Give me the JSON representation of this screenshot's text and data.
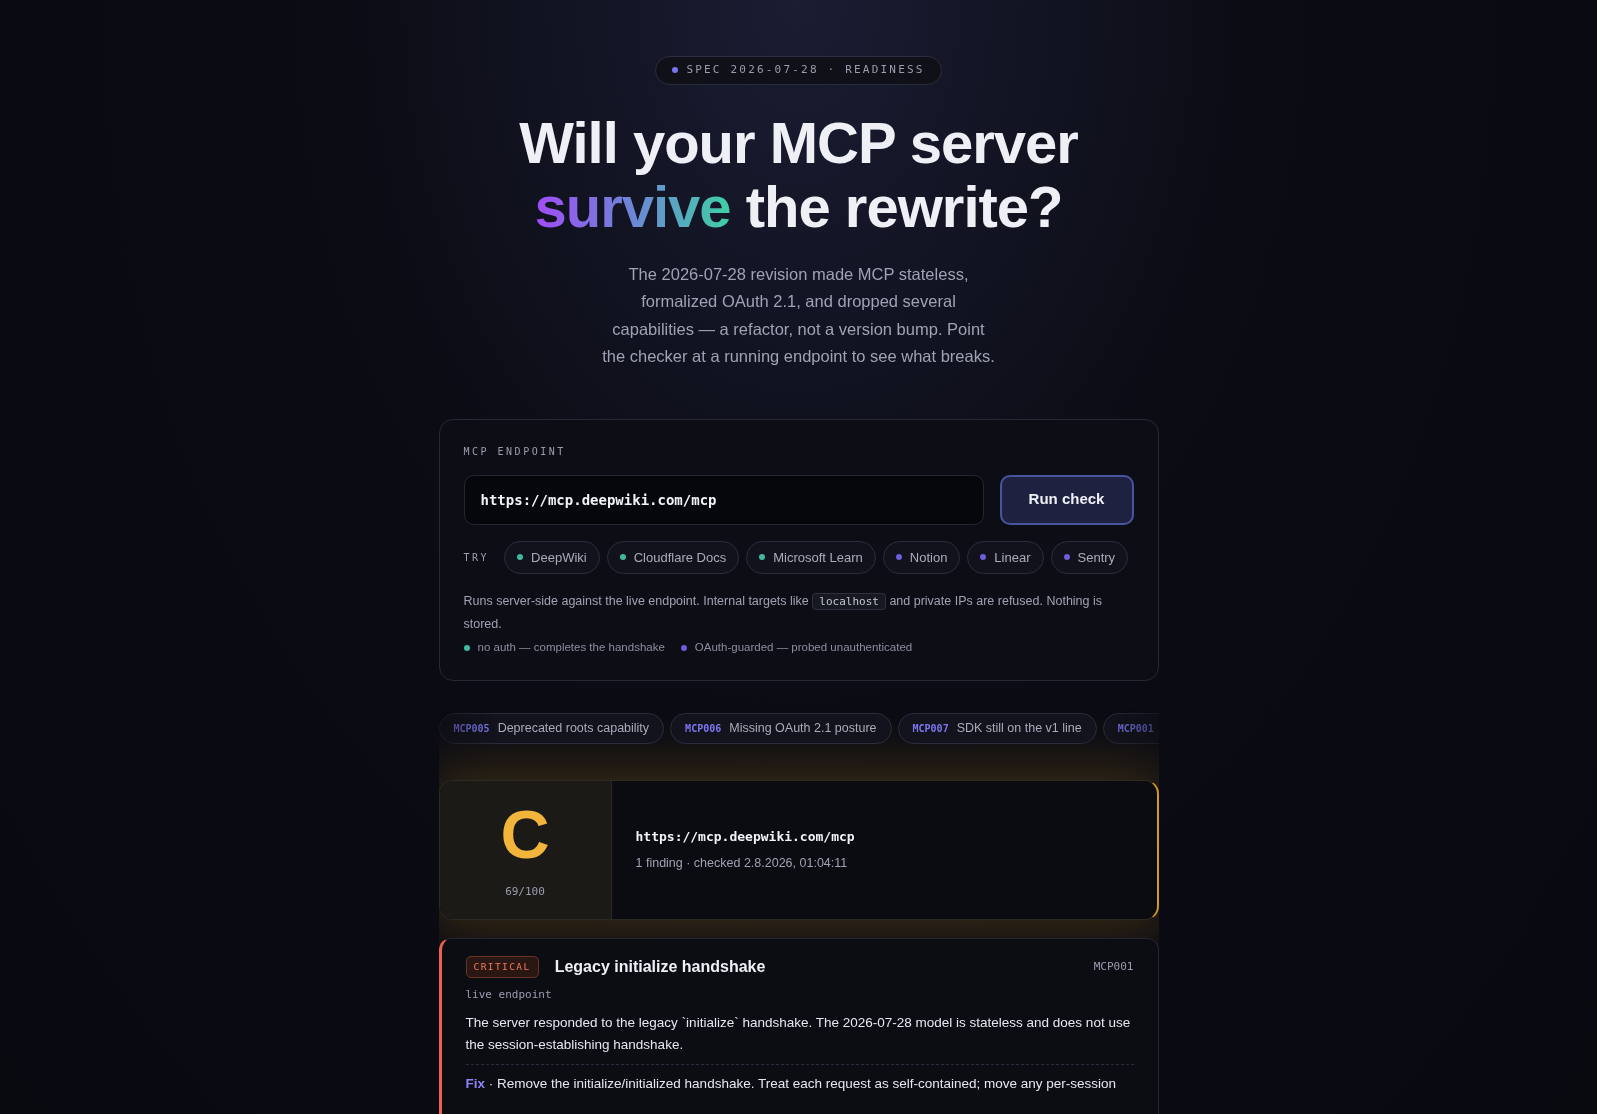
{
  "badge": {
    "text": "SPEC 2026-07-28 · READINESS"
  },
  "heading": {
    "line1": "Will your MCP server",
    "highlight": "survive",
    "rest": "the rewrite?"
  },
  "intro": "The 2026-07-28 revision made MCP stateless, formalized OAuth 2.1, and dropped several capabilities — a refactor, not a version bump. Point the checker at a running endpoint to see what breaks.",
  "form": {
    "label": "MCP ENDPOINT",
    "value": "https://mcp.deepwiki.com/mcp",
    "button": "Run check",
    "try_label": "TRY",
    "examples": [
      {
        "label": "DeepWiki",
        "color": "#3fb8a0"
      },
      {
        "label": "Cloudflare Docs",
        "color": "#3fb8a0"
      },
      {
        "label": "Microsoft Learn",
        "color": "#3fb8a0"
      },
      {
        "label": "Notion",
        "color": "#6a5fd8"
      },
      {
        "label": "Linear",
        "color": "#6a5fd8"
      },
      {
        "label": "Sentry",
        "color": "#6a5fd8"
      }
    ],
    "note_before": "Runs server-side against the live endpoint. Internal targets like",
    "note_code": "localhost",
    "note_after": "and private IPs are refused. Nothing is stored.",
    "legend": [
      {
        "label": "no auth — completes the handshake",
        "color": "#3fb8a0"
      },
      {
        "label": "OAuth-guarded — probed unauthenticated",
        "color": "#6a5fd8"
      }
    ]
  },
  "rules": [
    {
      "code": "MCP005",
      "title": "Deprecated roots capability"
    },
    {
      "code": "MCP006",
      "title": "Missing OAuth 2.1 posture"
    },
    {
      "code": "MCP007",
      "title": "SDK still on the v1 line"
    },
    {
      "code": "MCP001"
    }
  ],
  "result": {
    "grade": "C",
    "score": "69/100",
    "url": "https://mcp.deepwiki.com/mcp",
    "meta": "1 finding · checked 2.8.2026, 01:04:11"
  },
  "findings": [
    {
      "severity": "CRITICAL",
      "title": "Legacy initialize handshake",
      "code": "MCP001",
      "source": "live endpoint",
      "description": "The server responded to the legacy `initialize` handshake. The 2026-07-28 model is stateless and does not use the session-establishing handshake.",
      "fix_label": "Fix",
      "fix": "· Remove the initialize/initialized handshake. Treat each request as self-contained; move any per-session"
    }
  ]
}
